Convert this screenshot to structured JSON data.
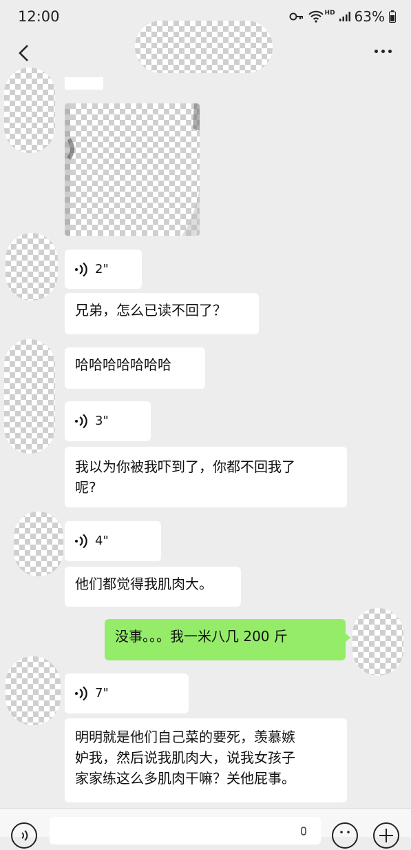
{
  "status_bar": {
    "time": "12:00",
    "battery": "63%",
    "hd": "HD"
  },
  "header": {
    "back_icon": "chevron-left-icon",
    "more_icon": "more-dots-icon"
  },
  "messages": [
    {
      "type": "image",
      "side": "left"
    },
    {
      "type": "voice",
      "side": "left",
      "duration": "2\""
    },
    {
      "type": "text",
      "side": "left",
      "text": "兄弟，怎么已读不回了？"
    },
    {
      "type": "text",
      "side": "left",
      "text": "哈哈哈哈哈哈哈"
    },
    {
      "type": "voice",
      "side": "left",
      "duration": "3\""
    },
    {
      "type": "text",
      "side": "left",
      "text": "我以为你被我吓到了，你都不回我了\n呢?"
    },
    {
      "type": "voice",
      "side": "left",
      "duration": "4\""
    },
    {
      "type": "text",
      "side": "left",
      "text": "他们都觉得我肌肉大。"
    },
    {
      "type": "text",
      "side": "right",
      "text": "没事。。。我一米八几 200 斤"
    },
    {
      "type": "voice",
      "side": "left",
      "duration": "7\""
    },
    {
      "type": "text",
      "side": "left",
      "text": "明明就是他们自己菜的要死，羡慕嫉\n妒我，然后说我肌肉大，说我女孩子\n家家练这么多肌肉干嘛？关他屁事。"
    }
  ],
  "colors": {
    "background": "#ededed",
    "my_bubble": "#95ec69",
    "their_bubble": "#ffffff"
  }
}
